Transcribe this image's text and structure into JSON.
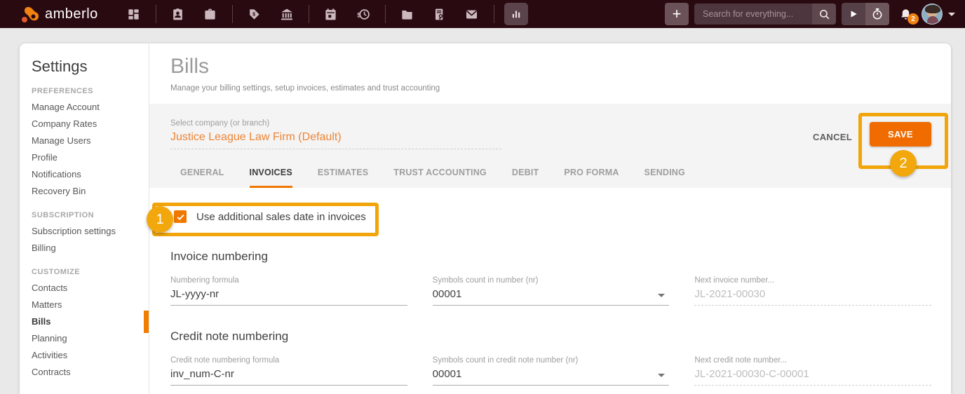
{
  "colors": {
    "topbar_bg": "#2a0a11",
    "accent_orange": "#f06c00",
    "tab_underline_orange": "#f07800",
    "link_orange": "#ee8434",
    "annotation_gold": "#f1a50b"
  },
  "topbar": {
    "logo_text": "amberlo",
    "plus_label": "+",
    "search_placeholder": "Search for everything...",
    "notification_badge": "2",
    "icons": [
      "apps-grid",
      "contacts-badge",
      "matters-briefcase",
      "billing-tag",
      "bank",
      "calendar",
      "time-billing",
      "documents-folder",
      "document-seal",
      "mail",
      "reports-chart",
      "plus",
      "search",
      "play",
      "timer",
      "bell",
      "avatar",
      "caret-down"
    ]
  },
  "sidebar": {
    "title": "Settings",
    "active_item": "Bills",
    "sections": [
      {
        "label": "PREFERENCES",
        "items": [
          "Manage Account",
          "Company Rates",
          "Manage Users",
          "Profile",
          "Notifications",
          "Recovery Bin"
        ]
      },
      {
        "label": "SUBSCRIPTION",
        "items": [
          "Subscription settings",
          "Billing"
        ]
      },
      {
        "label": "CUSTOMIZE",
        "items": [
          "Contacts",
          "Matters",
          "Bills",
          "Planning",
          "Activities",
          "Contracts"
        ]
      }
    ]
  },
  "main": {
    "page_title": "Bills",
    "page_subtitle": "Manage your billing settings, setup invoices, estimates and trust accounting",
    "company_select": {
      "label": "Select company (or branch)",
      "value": "Justice League Law Firm (Default)"
    },
    "cancel_label": "CANCEL",
    "save_label": "SAVE",
    "tabs": [
      "GENERAL",
      "INVOICES",
      "ESTIMATES",
      "TRUST ACCOUNTING",
      "DEBIT",
      "PRO FORMA",
      "SENDING"
    ],
    "active_tab": "INVOICES",
    "sales_date_checkbox": {
      "label": "Use additional sales date in invoices",
      "checked": true
    },
    "invoice_numbering": {
      "heading": "Invoice numbering",
      "formula": {
        "label": "Numbering formula",
        "value": "JL-yyyy-nr"
      },
      "symbols": {
        "label": "Symbols count in number (nr)",
        "value": "00001"
      },
      "next": {
        "label": "Next invoice number...",
        "value": "JL-2021-00030"
      }
    },
    "credit_note_numbering": {
      "heading": "Credit note numbering",
      "formula": {
        "label": "Credit note numbering formula",
        "value": "inv_num-C-nr"
      },
      "symbols": {
        "label": "Symbols count in credit note number (nr)",
        "value": "00001"
      },
      "next": {
        "label": "Next credit note number...",
        "value": "JL-2021-00030-C-00001"
      }
    },
    "annotations": {
      "step1": "1",
      "step2": "2"
    }
  }
}
